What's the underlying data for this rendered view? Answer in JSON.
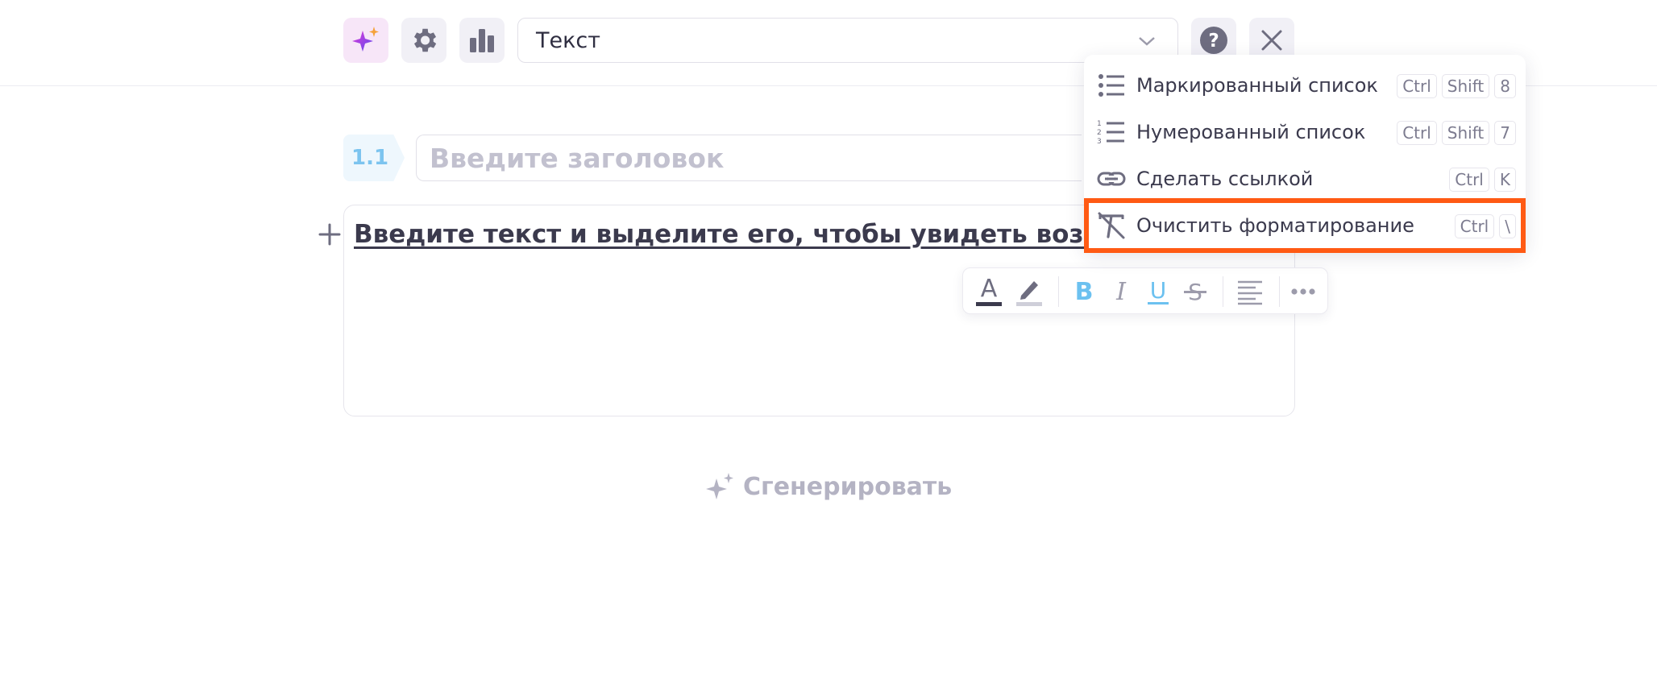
{
  "toolbar": {
    "magic_icon": "sparkles-icon",
    "settings_icon": "gear-icon",
    "stats_icon": "bar-chart-icon",
    "type_select": {
      "value": "Текст"
    },
    "help_icon": "question-icon",
    "close_icon": "close-icon"
  },
  "section": {
    "number": "1.1",
    "title_placeholder": "Введите заголовок"
  },
  "editor": {
    "text": "Введите текст и выделите его, чтобы увидеть возможности форматирования"
  },
  "format_bar": {
    "tools": [
      "text-color",
      "highlight",
      "bold",
      "italic",
      "underline",
      "strikethrough",
      "align",
      "more"
    ],
    "text_color": "#3b3a4d",
    "active_color": "#6cc1f0"
  },
  "generate": {
    "label": "Сгенерировать"
  },
  "menu": {
    "items": [
      {
        "label": "Маркированный список",
        "keys": [
          "Ctrl",
          "Shift",
          "8"
        ],
        "icon": "bulleted-list-icon"
      },
      {
        "label": "Нумерованный список",
        "keys": [
          "Ctrl",
          "Shift",
          "7"
        ],
        "icon": "numbered-list-icon"
      },
      {
        "label": "Сделать ссылкой",
        "keys": [
          "Ctrl",
          "K"
        ],
        "icon": "link-icon"
      },
      {
        "label": "Очистить форматирование",
        "keys": [
          "Ctrl",
          "\\"
        ],
        "icon": "clear-format-icon"
      }
    ],
    "highlight_color": "#ff5a14"
  }
}
